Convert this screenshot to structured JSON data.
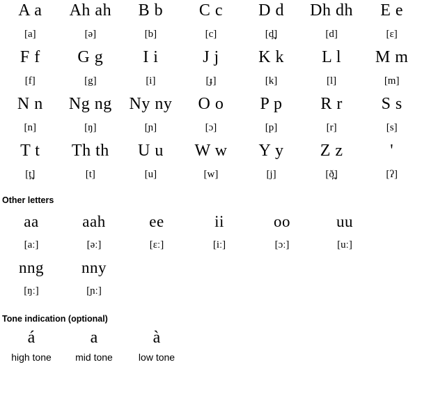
{
  "alphabet": {
    "rows": [
      {
        "letters": [
          "A a",
          "Ah ah",
          "B b",
          "C c",
          "D d",
          "Dh dh",
          "E e"
        ],
        "ipa": [
          "[a]",
          "[ə]",
          "[b]",
          "[c]",
          "[d̪]",
          "[d]",
          "[ɛ]"
        ]
      },
      {
        "letters": [
          "F f",
          "G g",
          "I i",
          "J j",
          "K k",
          "L l",
          "M m"
        ],
        "ipa": [
          "[f]",
          "[g]",
          "[i]",
          "[ɟ]",
          "[k]",
          "[l]",
          "[m]"
        ]
      },
      {
        "letters": [
          "N n",
          "Ng ng",
          "Ny ny",
          "O o",
          "P p",
          "R r",
          "S s"
        ],
        "ipa": [
          "[n]",
          "[ŋ]",
          "[ɲ]",
          "[ɔ]",
          "[p]",
          "[r]",
          "[s]"
        ]
      },
      {
        "letters": [
          "T t",
          "Th th",
          "U u",
          "W w",
          "Y y",
          "Z z",
          "'"
        ],
        "ipa": [
          "[t̪]",
          "[t]",
          "[u]",
          "[w]",
          "[j]",
          "[ð̪]",
          "[ʔ]"
        ]
      }
    ]
  },
  "other_letters": {
    "heading": "Other letters",
    "rows": [
      {
        "letters": [
          "aa",
          "aah",
          "ee",
          "ii",
          "oo",
          "uu"
        ],
        "ipa": [
          "[aː]",
          "[əː]",
          "[ɛː]",
          "[iː]",
          "[ɔː]",
          "[uː]"
        ]
      },
      {
        "letters": [
          "nng",
          "nny",
          "",
          "",
          "",
          ""
        ],
        "ipa": [
          "[ŋː]",
          "[ɲː]",
          "",
          "",
          "",
          ""
        ]
      }
    ]
  },
  "tone": {
    "heading": "Tone indication (optional)",
    "letters": [
      "á",
      "a",
      "à"
    ],
    "labels": [
      "high tone",
      "mid tone",
      "low tone"
    ]
  },
  "colors": {
    "text": "#000000",
    "background": "#ffffff"
  }
}
